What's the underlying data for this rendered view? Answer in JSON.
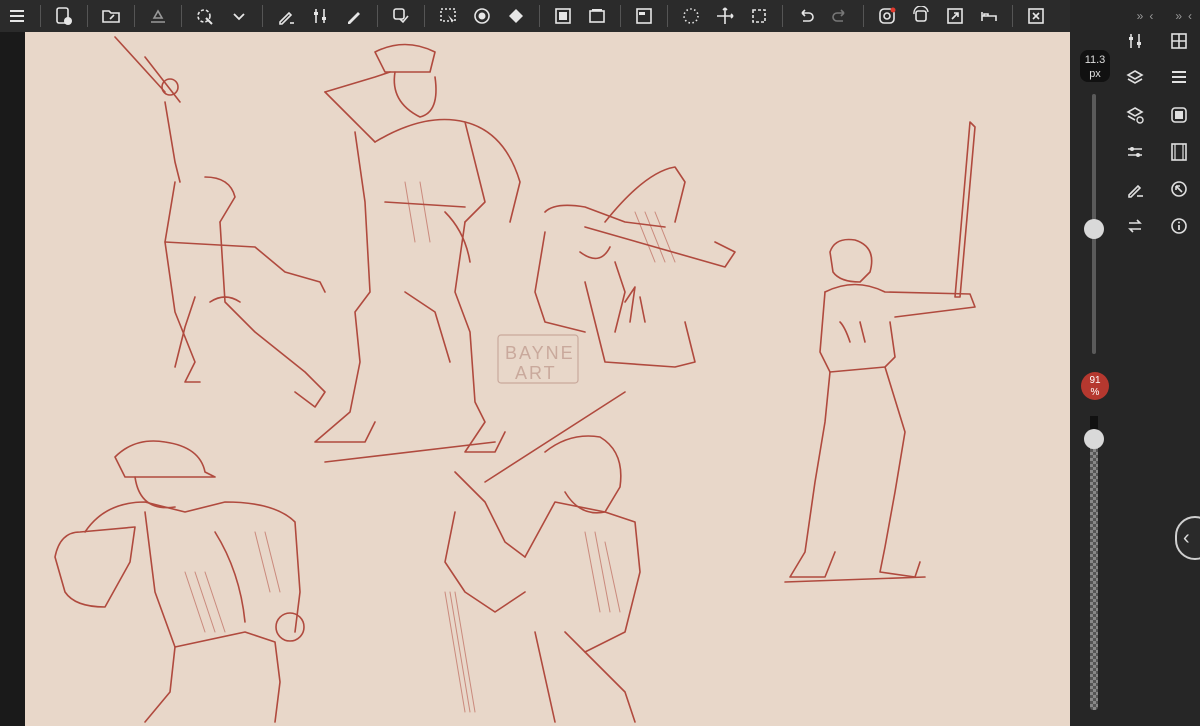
{
  "toolbar": {
    "buttons": [
      {
        "name": "menu-icon"
      },
      {
        "name": "new-canvas-icon"
      },
      {
        "name": "open-folder-icon"
      },
      {
        "name": "flip-tray-icon"
      },
      {
        "name": "magic-select-icon"
      },
      {
        "name": "chevron-down-icon"
      },
      {
        "name": "brush-settings-icon"
      },
      {
        "name": "adjust-icon"
      },
      {
        "name": "pen-icon"
      },
      {
        "name": "layer-transform-icon"
      },
      {
        "name": "selection-icon"
      },
      {
        "name": "fill-circle-icon"
      },
      {
        "name": "paint-bucket-icon"
      },
      {
        "name": "frame-icon"
      },
      {
        "name": "layers-stack-icon"
      },
      {
        "name": "panel-icon"
      },
      {
        "name": "loading-dots-icon"
      },
      {
        "name": "move-icon"
      },
      {
        "name": "crop-icon"
      },
      {
        "name": "undo-icon"
      },
      {
        "name": "redo-icon"
      },
      {
        "name": "record-icon"
      },
      {
        "name": "rotate-canvas-icon"
      },
      {
        "name": "expand-icon"
      },
      {
        "name": "bed-tool-icon"
      },
      {
        "name": "close-icon"
      }
    ]
  },
  "right_panel": {
    "brush_size": {
      "value": "11.3",
      "unit": "px"
    },
    "opacity": {
      "value": "91",
      "unit": "%"
    },
    "size_slider_level": 0.52,
    "opacity_slider_level": 0.91,
    "top_chevrons": [
      "»",
      "‹",
      "»",
      "‹"
    ]
  },
  "canvas": {
    "background": "#e8d7c9",
    "stroke_color": "#b04a3e",
    "watermark_line1": "BAYNE",
    "watermark_line2": "ART"
  },
  "colors": {
    "toolbar_bg": "#2b2b2b",
    "panel_bg": "#262626",
    "accent_red": "#b5382f"
  }
}
